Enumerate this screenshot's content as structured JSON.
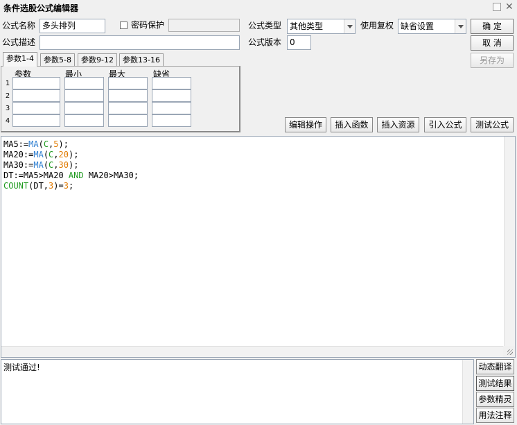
{
  "window": {
    "title": "条件选股公式编辑器"
  },
  "form": {
    "name_label": "公式名称",
    "name_value": "多头排列",
    "password_label": "密码保护",
    "password_value": "",
    "type_label": "公式类型",
    "type_value": "其他类型",
    "rights_label": "使用复权",
    "rights_value": "缺省设置",
    "desc_label": "公式描述",
    "desc_value": "",
    "version_label": "公式版本",
    "version_value": "0"
  },
  "buttons": {
    "ok": "确  定",
    "cancel": "取  消",
    "save_as": "另存为",
    "edit_ops": "编辑操作",
    "insert_func": "插入函数",
    "insert_res": "插入资源",
    "import_formula": "引入公式",
    "test_formula": "测试公式",
    "dynamic_translate": "动态翻译",
    "test_result": "测试结果",
    "param_wizard": "参数精灵",
    "usage_notes": "用法注释"
  },
  "tabs": [
    "参数1-4",
    "参数5-8",
    "参数9-12",
    "参数13-16"
  ],
  "params": {
    "headers": [
      "参数",
      "最小",
      "最大",
      "缺省"
    ],
    "rows": [
      "1",
      "2",
      "3",
      "4"
    ]
  },
  "code": {
    "line1": {
      "a": "MA5:=",
      "fn": "MA",
      "b": "(",
      "c": "C",
      "d": ",",
      "n": "5",
      "e": ");"
    },
    "line2": {
      "a": "MA20:=",
      "fn": "MA",
      "b": "(",
      "c": "C",
      "d": ",",
      "n": "20",
      "e": ");"
    },
    "line3": {
      "a": "MA30:=",
      "fn": "MA",
      "b": "(",
      "c": "C",
      "d": ",",
      "n": "30",
      "e": ");"
    },
    "line4": {
      "a": "DT:=MA5>MA20 ",
      "kw": "AND",
      "b": " MA20>MA30;"
    },
    "line5": {
      "fn": "COUNT",
      "b": "(DT,",
      "n1": "3",
      "c": ")=",
      "n2": "3",
      "d": ";"
    }
  },
  "result": {
    "text": "测试通过!"
  },
  "colors": {
    "function": "#2e7fd1",
    "keyword": "#1f9a1f",
    "number": "#e07a00"
  }
}
